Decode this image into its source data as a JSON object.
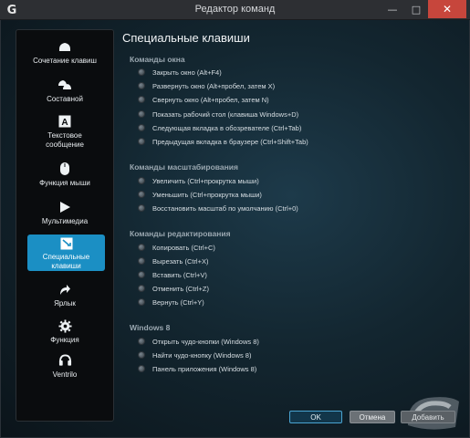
{
  "window": {
    "title": "Редактор команд",
    "controls": {
      "minimize": "—",
      "maximize": "□",
      "close": "✕"
    }
  },
  "sidebar": {
    "items": [
      {
        "label": "Сочетание клавиш",
        "icon": "keyboard-shortcut-icon"
      },
      {
        "label": "Составной",
        "icon": "multikey-icon"
      },
      {
        "label": "Текстовое сообщение",
        "icon": "text-block-icon"
      },
      {
        "label": "Функция мыши",
        "icon": "mouse-icon"
      },
      {
        "label": "Мультимедиа",
        "icon": "play-icon"
      },
      {
        "label": "Специальные клавиши",
        "icon": "special-keys-icon",
        "active": true
      },
      {
        "label": "Ярлык",
        "icon": "shortcut-arrow-icon"
      },
      {
        "label": "Функция",
        "icon": "gear-icon"
      },
      {
        "label": "Ventrilo",
        "icon": "headset-icon"
      }
    ]
  },
  "content": {
    "title": "Специальные клавиши",
    "sections": [
      {
        "title": "Команды окна",
        "options": [
          "Закрыть окно (Alt+F4)",
          "Развернуть окно (Alt+пробел, затем X)",
          "Свернуть окно (Alt+пробел, затем N)",
          "Показать рабочий стол (клавиша Windows+D)",
          "Следующая вкладка в обозревателе (Ctrl+Tab)",
          "Предыдущая вкладка в браузере (Ctrl+Shift+Tab)"
        ]
      },
      {
        "title": "Команды масштабирования",
        "options": [
          "Увеличить (Ctrl+прокрутка мыши)",
          "Уменьшить (Ctrl+прокрутка мыши)",
          "Восстановить масштаб по умолчанию (Ctrl+0)"
        ]
      },
      {
        "title": "Команды редактирования",
        "options": [
          "Копировать (Ctrl+C)",
          "Вырезать (Ctrl+X)",
          "Вставить (Ctrl+V)",
          "Отменить (Ctrl+Z)",
          "Вернуть (Ctrl+Y)"
        ]
      },
      {
        "title": "Windows 8",
        "options": [
          "Открыть чудо-кнопки (Windows 8)",
          "Найти чудо-кнопку (Windows 8)",
          "Панель приложения (Windows 8)"
        ]
      }
    ]
  },
  "buttons": {
    "ok": "OK",
    "cancel": "Отмена",
    "add": "Добавить"
  },
  "colors": {
    "accent": "#1b8fc4",
    "close": "#c7463c",
    "background": "#132630"
  }
}
